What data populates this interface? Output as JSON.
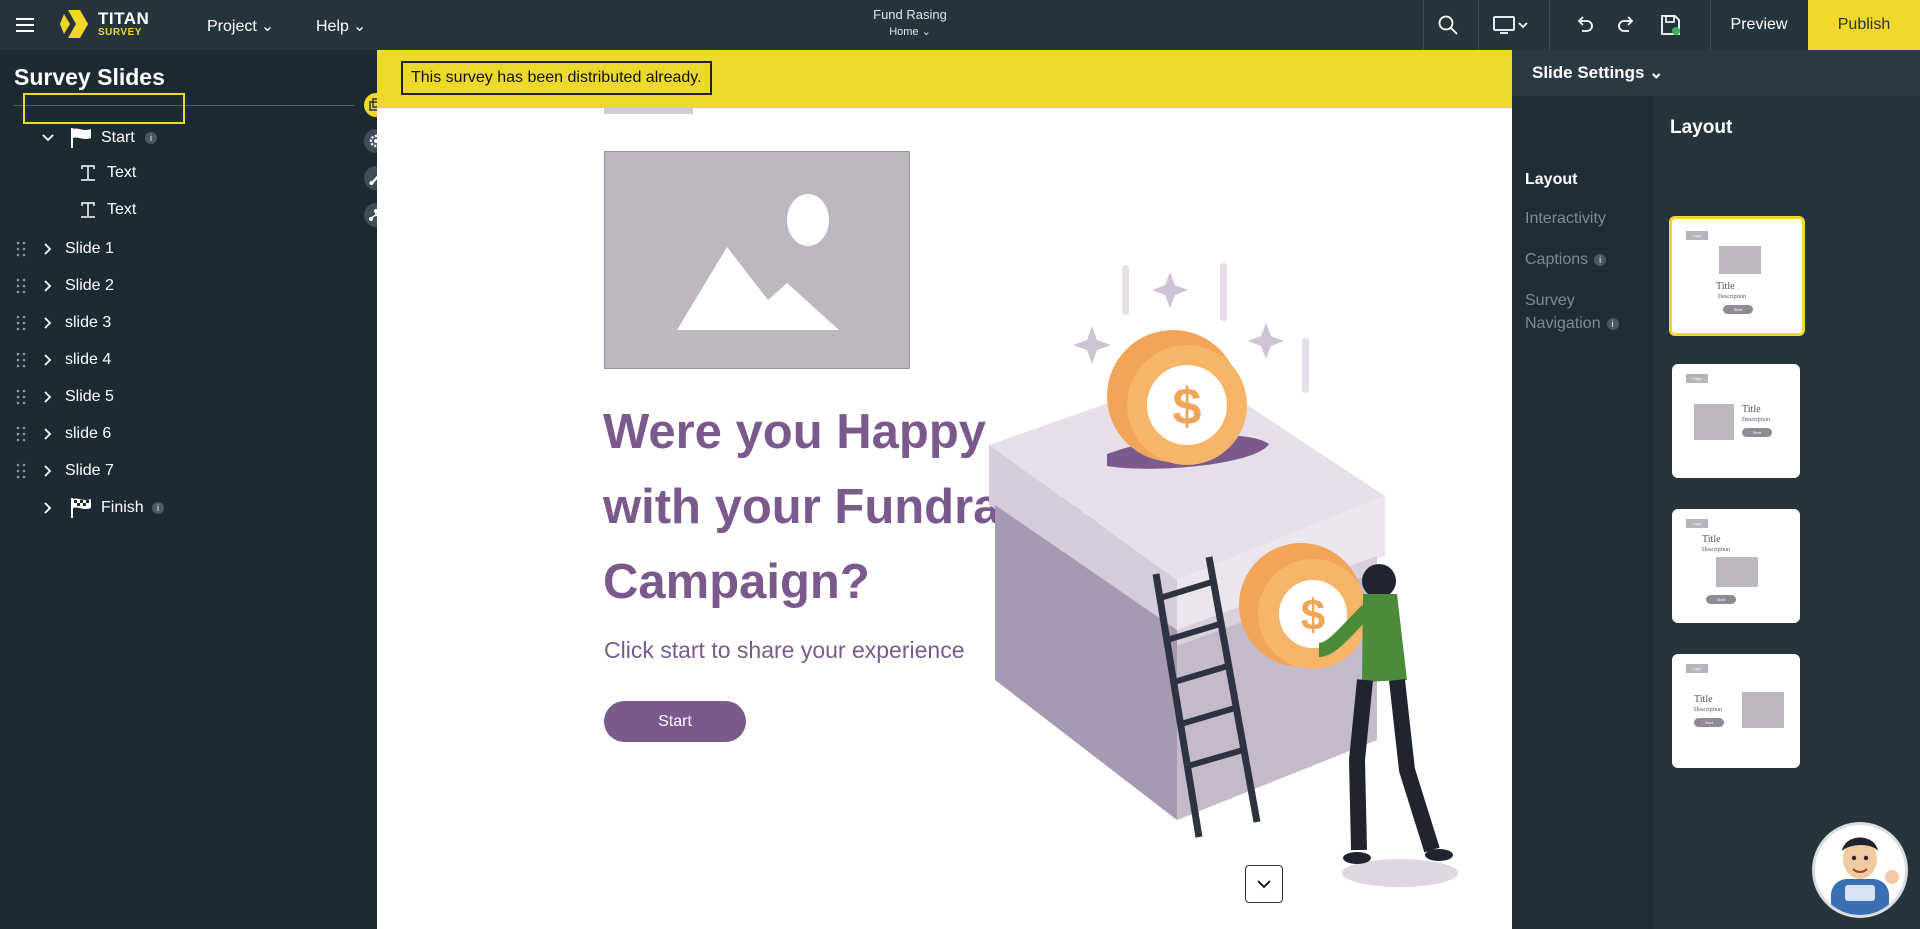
{
  "app": {
    "logo_title": "TITAN",
    "logo_subtitle": "SURVEY"
  },
  "topbar": {
    "menus": [
      {
        "label": "Project"
      },
      {
        "label": "Help"
      }
    ],
    "doc_title": "Fund Rasing",
    "doc_subtitle": "Home",
    "preview_label": "Preview",
    "publish_label": "Publish",
    "accent": "#f0d82a"
  },
  "sidebar": {
    "title": "Survey Slides",
    "items": [
      {
        "label": "Start",
        "badge": "i"
      },
      {
        "label": "Text"
      },
      {
        "label": "Text"
      },
      {
        "label": "Slide 1"
      },
      {
        "label": "Slide 2"
      },
      {
        "label": "slide 3"
      },
      {
        "label": "slide 4"
      },
      {
        "label": "Slide 5"
      },
      {
        "label": "slide 6"
      },
      {
        "label": "Slide 7"
      },
      {
        "label": "Finish",
        "badge": "i"
      }
    ]
  },
  "canvas": {
    "banner": "This survey has been distributed already.",
    "headline_lines": [
      "Were you Happy",
      "with your Fundraising",
      "Campaign?"
    ],
    "subline": "Click start to share your experience",
    "start_label": "Start",
    "theme_color": "#7a5a8c",
    "banner_color": "#ecd92c"
  },
  "right_panel": {
    "header": "Slide Settings",
    "nav": [
      {
        "label": "Layout",
        "active": true
      },
      {
        "label": "Interactivity"
      },
      {
        "label": "Captions",
        "badge": "i"
      },
      {
        "label": "Survey",
        "label2": "Navigation",
        "badge": "i"
      }
    ],
    "content_title": "Layout",
    "layouts": [
      {
        "logo": "Logo",
        "title": "Title",
        "desc": "Description",
        "btn": "Start",
        "selected": true
      },
      {
        "logo": "Logo",
        "title": "Title",
        "desc": "Description",
        "btn": "Start"
      },
      {
        "logo": "Logo",
        "title": "Title",
        "desc": "Description",
        "btn": "Start"
      },
      {
        "logo": "Logo",
        "title": "Title",
        "desc": "Description",
        "btn": "Start"
      }
    ]
  }
}
